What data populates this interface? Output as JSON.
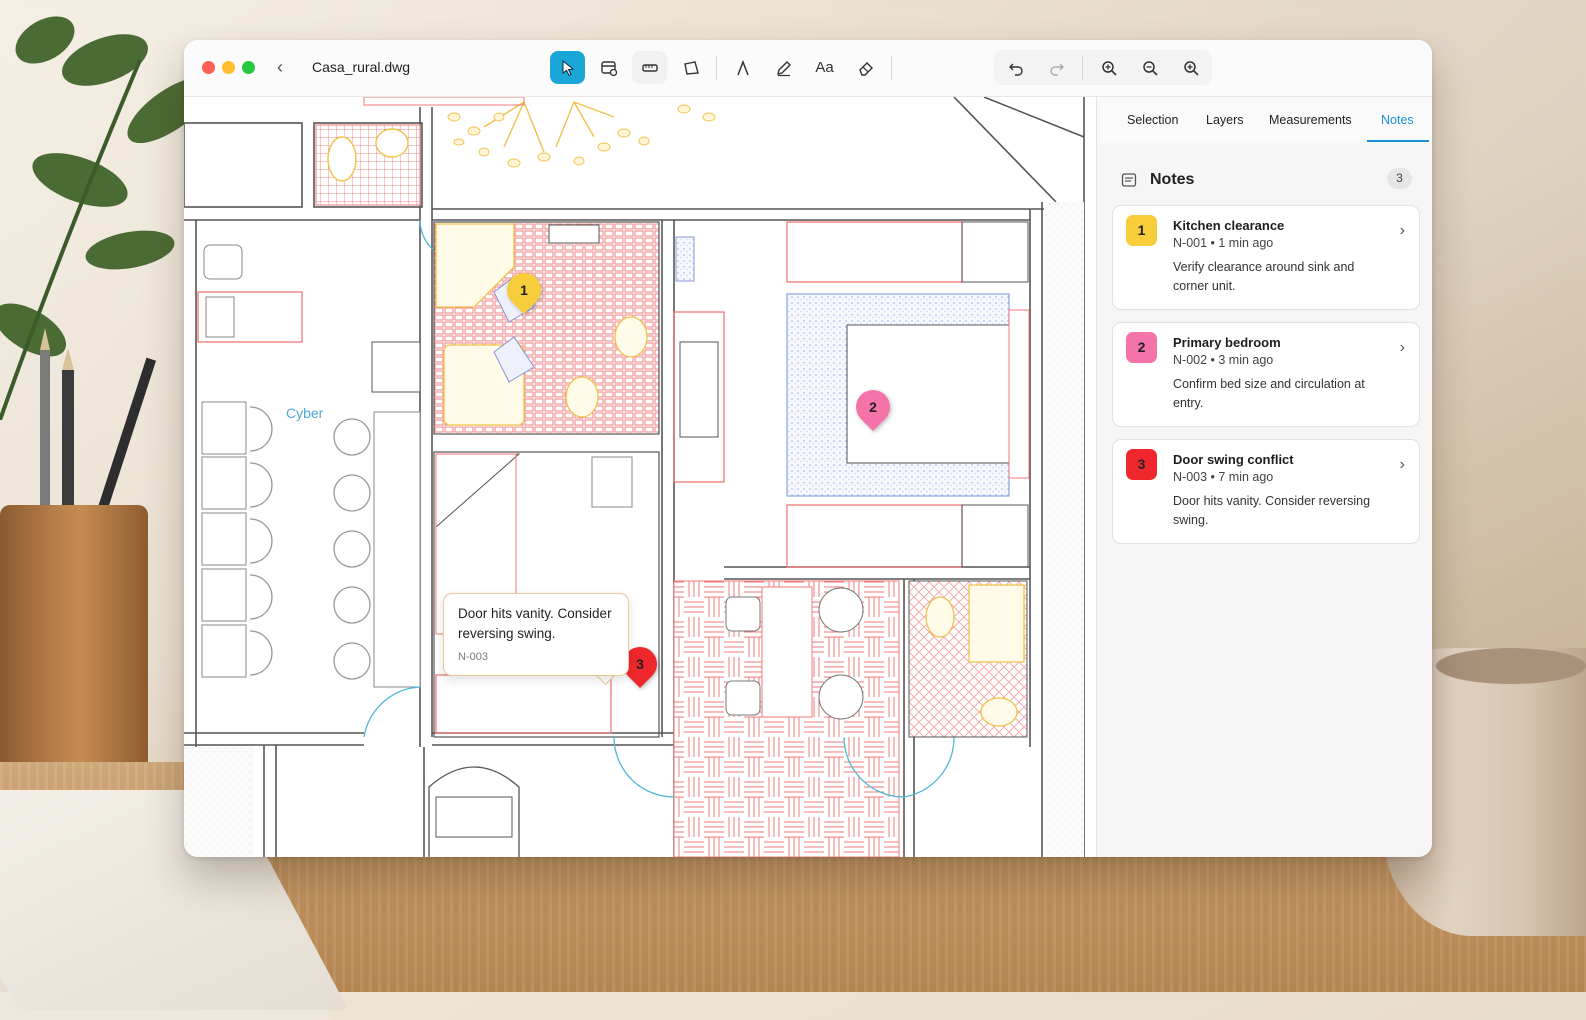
{
  "window": {
    "doc_title": "Casa_rural.dwg"
  },
  "toolbar": {
    "tools": [
      "select-tool",
      "layer-tool",
      "measure-tool",
      "polygon-tool",
      "text-path-tool",
      "pen-tool",
      "text-tool",
      "eraser-tool"
    ],
    "text_tool_label": "Aa",
    "view_tools": [
      "undo",
      "redo",
      "zoom-in",
      "zoom-out",
      "zoom-fit"
    ]
  },
  "tabs": [
    {
      "label": "Selection",
      "active": false
    },
    {
      "label": "Layers",
      "active": false
    },
    {
      "label": "Measurements",
      "active": false
    },
    {
      "label": "Notes",
      "active": true
    }
  ],
  "notes_panel": {
    "title": "Notes",
    "count": "3",
    "items": [
      {
        "num": "1",
        "title": "Kitchen clearance",
        "meta": "N-001 • 1 min ago",
        "body": "Verify clearance around sink and corner unit.",
        "color": "#f8cd3c"
      },
      {
        "num": "2",
        "title": "Primary bedroom",
        "meta": "N-002 • 3 min ago",
        "body": "Confirm bed size and circulation at entry.",
        "color": "#f473a8"
      },
      {
        "num": "3",
        "title": "Door swing conflict",
        "meta": "N-003 • 7 min ago",
        "body": "Door hits vanity. Consider reversing swing.",
        "color": "#f0282d"
      }
    ]
  },
  "canvas": {
    "room_label": "Cyber",
    "pins": [
      {
        "num": "1",
        "color": "#f8cd3c"
      },
      {
        "num": "2",
        "color": "#f473a8"
      },
      {
        "num": "3",
        "color": "#f0282d"
      }
    ],
    "tooltip": {
      "text": "Door hits vanity. Consider reversing swing.",
      "id": "N-003"
    }
  },
  "colors": {
    "accent": "#1aa7d8",
    "tab_active": "#1a8fd6"
  }
}
